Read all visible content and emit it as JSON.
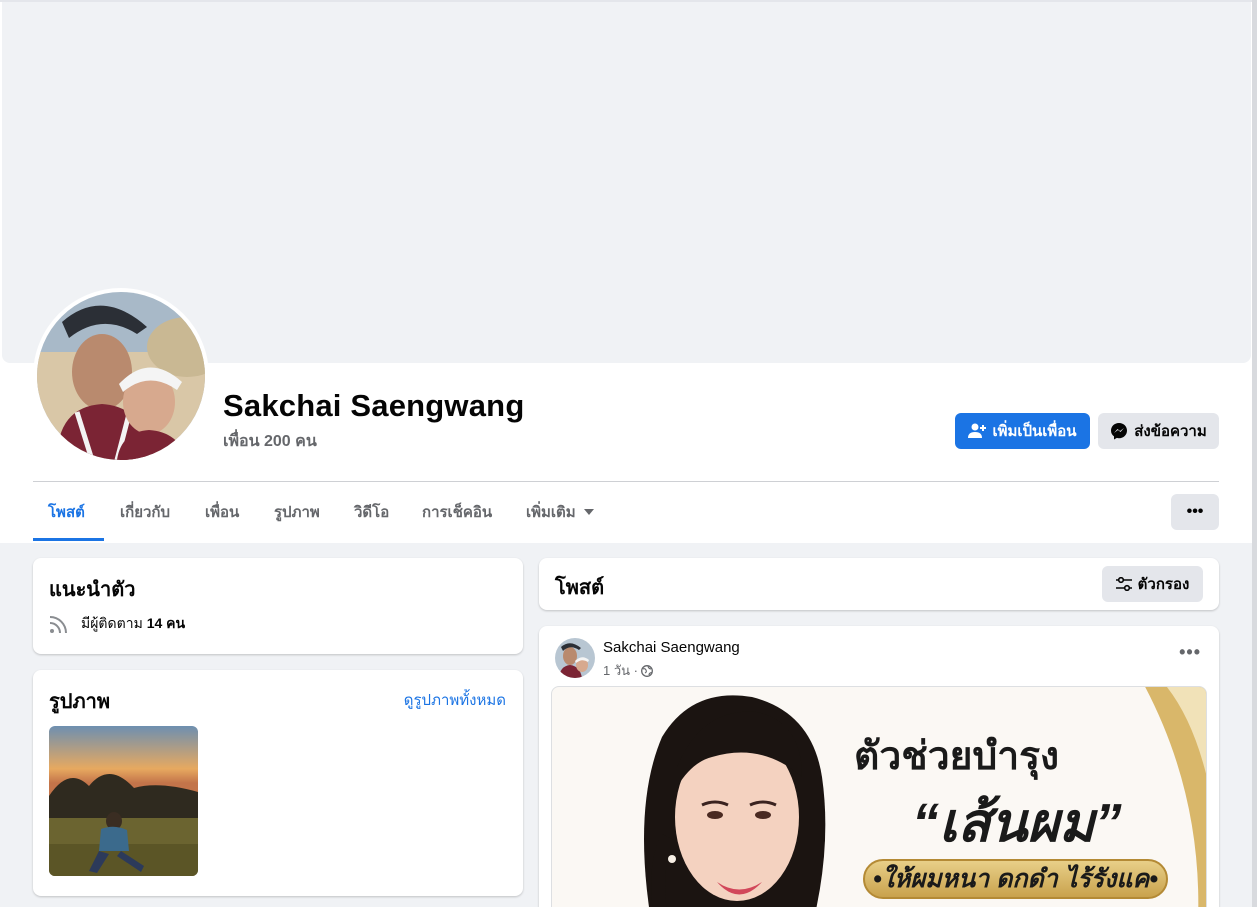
{
  "profile": {
    "name": "Sakchai Saengwang",
    "friends": "เพื่อน 200 คน"
  },
  "actions": {
    "add_friend": "เพิ่มเป็นเพื่อน",
    "message": "ส่งข้อความ"
  },
  "tabs": [
    {
      "label": "โพสต์"
    },
    {
      "label": "เกี่ยวกับ"
    },
    {
      "label": "เพื่อน"
    },
    {
      "label": "รูปภาพ"
    },
    {
      "label": "วิดีโอ"
    },
    {
      "label": "การเช็คอิน"
    },
    {
      "label": "เพิ่มเติม"
    }
  ],
  "more_menu": "•••",
  "intro": {
    "title": "แนะนำตัว",
    "followers_prefix": "มีผู้ติดตาม ",
    "followers_count": "14 คน"
  },
  "photos": {
    "title": "รูปภาพ",
    "see_all": "ดูรูปภาพทั้งหมด"
  },
  "posts": {
    "title": "โพสต์",
    "filter": "ตัวกรอง"
  },
  "post": {
    "author": "Sakchai Saengwang",
    "time": "1 วัน ·",
    "more": "•••",
    "ad": {
      "line1": "ตัวช่วยบำรุง",
      "line2": "“เส้นผม”",
      "pill": "•ให้ผมหนา ดกดำ ไร้รังแค•"
    }
  },
  "colors": {
    "accent": "#1b74e4",
    "background": "#f0f2f5",
    "secondary_button": "#e4e6eb",
    "muted_text": "#65676b"
  }
}
